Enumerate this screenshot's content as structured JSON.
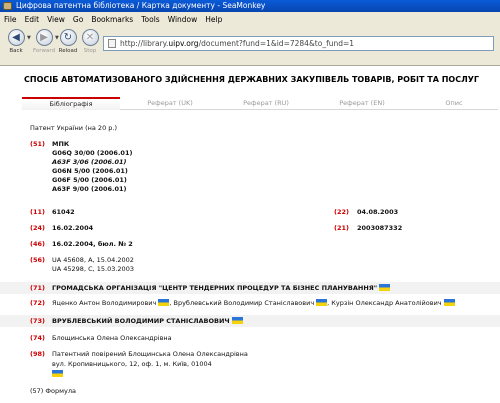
{
  "window": {
    "title": "Цифрова патентна бібліотека / Картка документу - SeaMonkey"
  },
  "menu": [
    "File",
    "Edit",
    "View",
    "Go",
    "Bookmarks",
    "Tools",
    "Window",
    "Help"
  ],
  "toolbar": {
    "back": "Back",
    "forward": "Forward",
    "reload": "Reload",
    "stop": "Stop",
    "url_prefix": "http://library.",
    "url_domain": "uipv.org",
    "url_suffix": "/document?fund=1&id=7284&to_fund=1"
  },
  "document": {
    "title": "СПОСІБ АВТОМАТИЗОВАНОГО ЗДІЙСНЕННЯ ДЕРЖАВНИХ ЗАКУПІВЕЛЬ ТОВАРІВ, РОБІТ ТА ПОСЛУГ",
    "tabs": [
      {
        "label": "Бібліографія",
        "active": true
      },
      {
        "label": "Реферат (UK)",
        "active": false
      },
      {
        "label": "Реферат (RU)",
        "active": false
      },
      {
        "label": "Реферат (EN)",
        "active": false
      },
      {
        "label": "Опис",
        "active": false
      }
    ],
    "patent_type": "Патент України (на 20 р.)",
    "ipc": {
      "code": "(51)",
      "label": "МПК",
      "classes": [
        "G06Q 30/00 (2006.01)",
        "A63F 3/06 (2006.01)",
        "G06N 5/00 (2006.01)",
        "G06F 5/00 (2006.01)",
        "A63F 9/00 (2006.01)"
      ]
    },
    "fields": {
      "c11": "(11)",
      "v11": "61042",
      "c22": "(22)",
      "v22": "04.08.2003",
      "c24": "(24)",
      "v24": "16.02.2004",
      "c21": "(21)",
      "v21": "2003087332",
      "c46": "(46)",
      "v46": "16.02.2004, бюл. № 2",
      "c56": "(56)",
      "v56a": "UA 45608, A, 15.04.2002",
      "v56b": "UA 45298, C, 15.03.2003",
      "c71": "(71)",
      "v71": "ГРОМАДСЬКА ОРГАНІЗАЦІЯ \"ЦЕНТР ТЕНДЕРНИХ ПРОЦЕДУР ТА БІЗНЕС ПЛАНУВАННЯ\"",
      "c72": "(72)",
      "inventors": [
        "Яценко Антон Володимирович",
        "Врублевський Володимир Станіславович",
        "Курзін Олександр Анатолійович"
      ],
      "c73": "(73)",
      "v73": "ВРУБЛЕВСЬКИЙ ВОЛОДИМИР СТАНІСЛАВОВИЧ",
      "c74": "(74)",
      "v74": "Блощинська Олена Олександрівна",
      "c98": "(98)",
      "v98a": "Патентний повірений Блощинська Олена Олександрівна",
      "v98b": "вул. Кропивницького, 12, оф. 1, м. Київ, 01004"
    },
    "formula": "(57) Формула"
  }
}
